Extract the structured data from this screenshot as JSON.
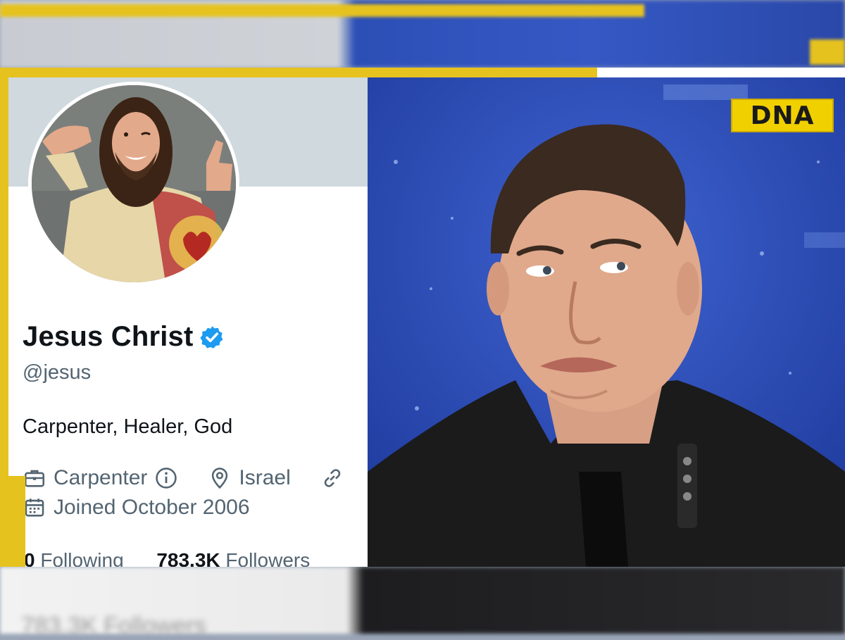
{
  "profile": {
    "name": "Jesus Christ",
    "handle": "@jesus",
    "bio": "Carpenter, Healer, God",
    "profession": "Carpenter",
    "location": "Israel",
    "joined": "Joined October 2006",
    "following_count": "0",
    "following_label": "Following",
    "followers_count": "783.3K",
    "followers_label": "Followers",
    "verified_badge_color": "#1d9bf0"
  },
  "badge": {
    "label": "DNA",
    "color": "#f1d000"
  },
  "blurred_bottom": {
    "text": "783.3K Followers"
  },
  "icons": {
    "profession": "briefcase-icon",
    "info": "info-icon",
    "location": "location-pin-icon",
    "link": "link-icon",
    "calendar": "calendar-icon",
    "verified": "verified-badge-icon"
  },
  "colors": {
    "frame_accent": "#e6c21f",
    "text_primary": "#0f1419",
    "text_secondary": "#536471"
  }
}
